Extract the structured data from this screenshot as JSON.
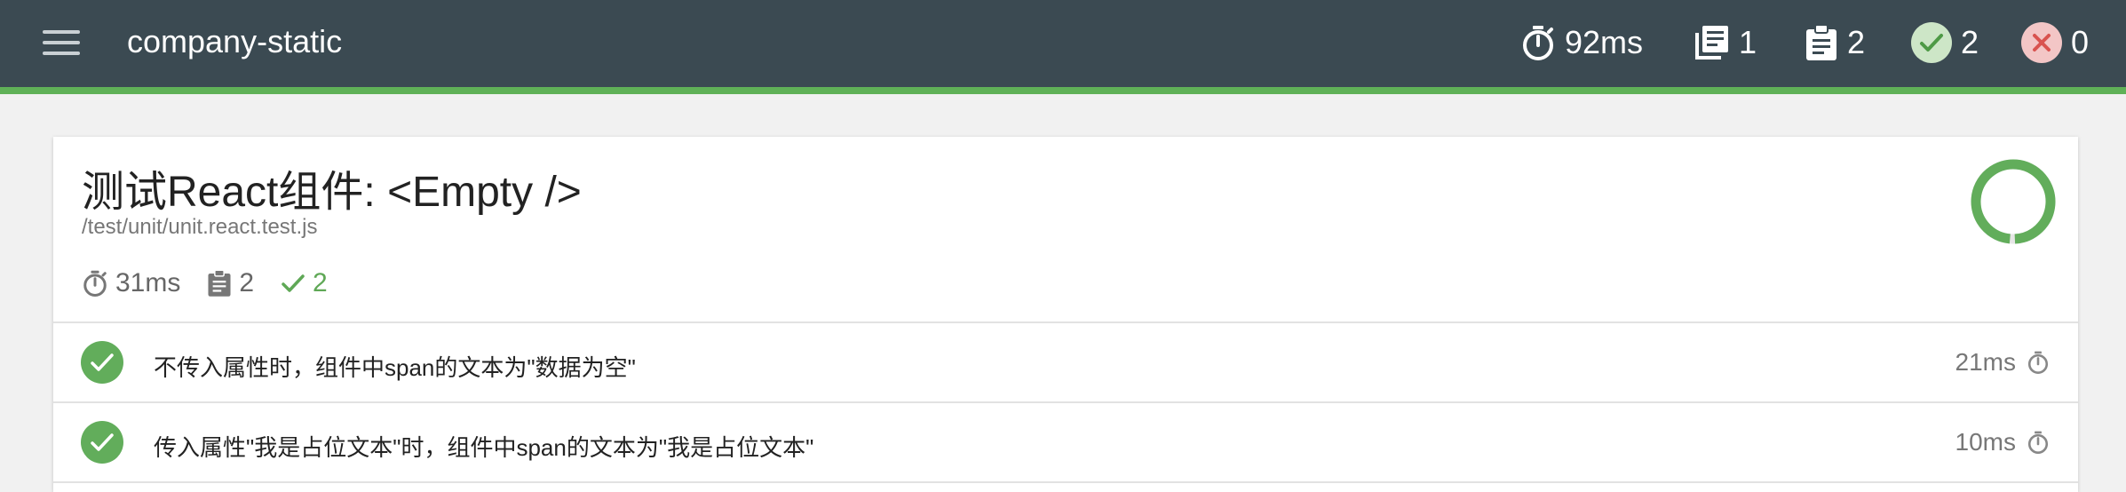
{
  "header": {
    "title": "company-static",
    "stats": {
      "duration": "92ms",
      "suites": "1",
      "tests": "2",
      "passed": "2",
      "failed": "0"
    }
  },
  "suite": {
    "title": "测试React组件: <Empty />",
    "path": "/test/unit/unit.react.test.js",
    "duration": "31ms",
    "tests": "2",
    "passed": "2",
    "pass_fraction": 1.0
  },
  "tests": [
    {
      "name": "不传入属性时，组件中span的文本为\"数据为空\"",
      "duration": "21ms",
      "status": "passed"
    },
    {
      "name": "传入属性\"我是占位文本\"时，组件中span的文本为\"我是占位文本\"",
      "duration": "10ms",
      "status": "passed"
    }
  ],
  "colors": {
    "header_bg": "#3b4a52",
    "accent_green": "#5fb157",
    "pass_badge": "#62ad5b",
    "pass_badge_light": "#cde6c7",
    "fail_badge_light": "#f3c6c6",
    "fail_mark": "#d9534f"
  },
  "icons": {
    "menu": "hamburger-menu-icon",
    "duration": "stopwatch-icon",
    "suites": "library-books-icon",
    "tests": "clipboard-icon",
    "passed": "check-circle-icon",
    "failed": "close-circle-icon"
  }
}
